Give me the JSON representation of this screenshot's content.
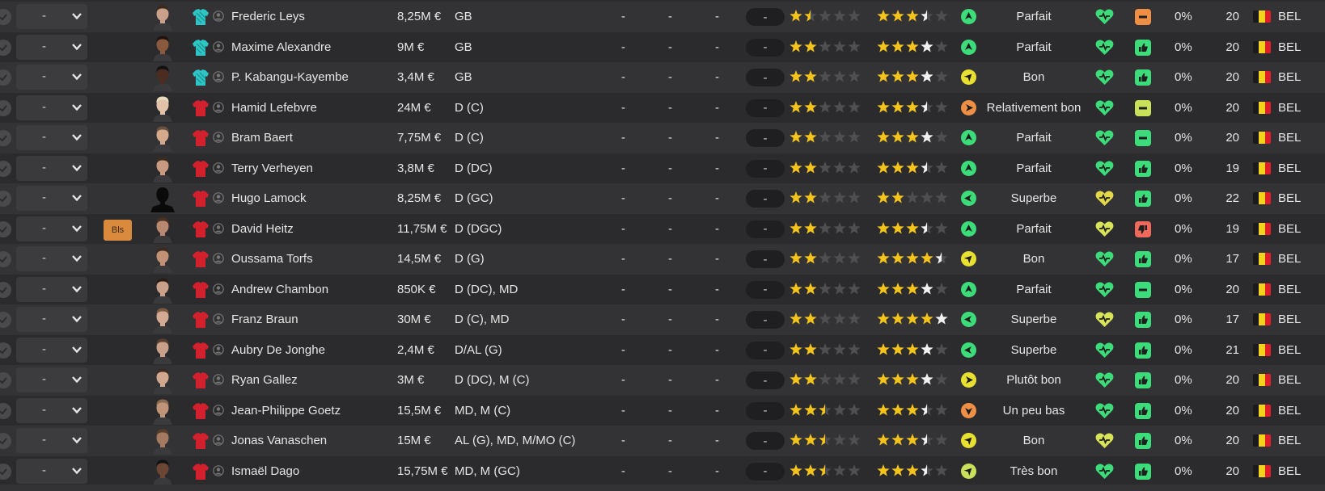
{
  "colors": {
    "star_gold": "#f5c41b",
    "star_white": "#f2f2f2",
    "star_empty": "#4f4f51",
    "heart_green": "#3ddc7a",
    "heart_yellow": "#d8e35a",
    "mood_green": "#3ddc7a",
    "mood_orange": "#ef8f45",
    "mood_red": "#ef6a5a",
    "mood_yellowgreen": "#c8e05a",
    "gk_shirt": "#2dc5c5",
    "outfield_shirt": "#d2202d",
    "badge": "#d98a3d"
  },
  "flag": {
    "black": "#1a1a1a",
    "yellow": "#f4d31e",
    "red": "#e01e2a"
  },
  "rows": [
    {
      "dash": "-",
      "badge": "",
      "shirt": "gk",
      "name": "Frederic Leys",
      "value": "8,25M €",
      "position": "GB",
      "d1": "-",
      "d2": "-",
      "d3": "-",
      "pill": "-",
      "stars1": 1.5,
      "stars2": 3.5,
      "arrow_icon": "up-arrow-green",
      "level": "Parfait",
      "heart_color": "green",
      "mood_icon": "minus-orange",
      "pct": "0%",
      "age": "20",
      "nat": "BEL"
    },
    {
      "dash": "-",
      "badge": "",
      "shirt": "gk",
      "name": "Maxime Alexandre",
      "value": "9M €",
      "position": "GB",
      "d1": "-",
      "d2": "-",
      "d3": "-",
      "pill": "-",
      "stars1": 2,
      "stars2": 3,
      "arrow_icon": "up-arrow-green",
      "level": "Parfait",
      "heart_color": "green",
      "mood_icon": "thumb-up-green",
      "pct": "0%",
      "age": "20",
      "nat": "BEL"
    },
    {
      "dash": "-",
      "badge": "",
      "shirt": "gk",
      "name": "P. Kabangu-Kayembe",
      "value": "3,4M €",
      "position": "GB",
      "d1": "-",
      "d2": "-",
      "d3": "-",
      "pill": "-",
      "stars1": 2,
      "stars2": 3,
      "arrow_icon": "diag-arrow-yellow",
      "level": "Bon",
      "heart_color": "green",
      "mood_icon": "thumb-up-green",
      "pct": "0%",
      "age": "20",
      "nat": "BEL"
    },
    {
      "dash": "-",
      "badge": "",
      "shirt": "field",
      "name": "Hamid Lefebvre",
      "value": "24M €",
      "position": "D (C)",
      "d1": "-",
      "d2": "-",
      "d3": "-",
      "pill": "-",
      "stars1": 2,
      "stars2": 3.5,
      "arrow_icon": "right-arrow-orange",
      "level": "Relativement bon",
      "heart_color": "green",
      "mood_icon": "minus-yellowgreen",
      "pct": "0%",
      "age": "20",
      "nat": "BEL"
    },
    {
      "dash": "-",
      "badge": "",
      "shirt": "field",
      "name": "Bram Baert",
      "value": "7,75M €",
      "position": "D (C)",
      "d1": "-",
      "d2": "-",
      "d3": "-",
      "pill": "-",
      "stars1": 2,
      "stars2": 3,
      "arrow_icon": "up-arrow-green",
      "level": "Parfait",
      "heart_color": "green",
      "mood_icon": "minus-green",
      "pct": "0%",
      "age": "20",
      "nat": "BEL"
    },
    {
      "dash": "-",
      "badge": "",
      "shirt": "field",
      "name": "Terry Verheyen",
      "value": "3,8M €",
      "position": "D (DC)",
      "d1": "-",
      "d2": "-",
      "d3": "-",
      "pill": "-",
      "stars1": 2,
      "stars2": 3.5,
      "arrow_icon": "up-arrow-green",
      "level": "Parfait",
      "heart_color": "green",
      "mood_icon": "thumb-up-green",
      "pct": "0%",
      "age": "19",
      "nat": "BEL"
    },
    {
      "dash": "-",
      "badge": "",
      "shirt": "field",
      "name": "Hugo Lamock",
      "value": "8,25M €",
      "position": "D (GC)",
      "d1": "-",
      "d2": "-",
      "d3": "-",
      "pill": "-",
      "stars1": 2,
      "stars2": 2,
      "arrow_icon": "left-arrow-green",
      "level": "Superbe",
      "heart_color": "yellow",
      "mood_icon": "thumb-up-green",
      "pct": "0%",
      "age": "22",
      "nat": "BEL"
    },
    {
      "dash": "-",
      "badge": "Bls",
      "shirt": "field",
      "name": "David Heitz",
      "value": "11,75M €",
      "position": "D (DGC)",
      "d1": "-",
      "d2": "-",
      "d3": "-",
      "pill": "-",
      "stars1": 2,
      "stars2": 3.5,
      "arrow_icon": "up-arrow-green",
      "level": "Parfait",
      "heart_color": "yellowgreen",
      "mood_icon": "thumb-down-red",
      "pct": "0%",
      "age": "19",
      "nat": "BEL"
    },
    {
      "dash": "-",
      "badge": "",
      "shirt": "field",
      "name": "Oussama Torfs",
      "value": "14,5M €",
      "position": "D (G)",
      "d1": "-",
      "d2": "-",
      "d3": "-",
      "pill": "-",
      "stars1": 2,
      "stars2": 4.5,
      "arrow_icon": "diag-arrow-yellow",
      "level": "Bon",
      "heart_color": "green",
      "mood_icon": "thumb-up-green",
      "pct": "0%",
      "age": "17",
      "nat": "BEL"
    },
    {
      "dash": "-",
      "badge": "",
      "shirt": "field",
      "name": "Andrew Chambon",
      "value": "850K €",
      "position": "D (DC), MD",
      "d1": "-",
      "d2": "-",
      "d3": "-",
      "pill": "-",
      "stars1": 2,
      "stars2": 3,
      "arrow_icon": "up-arrow-green",
      "level": "Parfait",
      "heart_color": "green",
      "mood_icon": "minus-green",
      "pct": "0%",
      "age": "20",
      "nat": "BEL"
    },
    {
      "dash": "-",
      "badge": "",
      "shirt": "field",
      "name": "Franz Braun",
      "value": "30M €",
      "position": "D (C), MD",
      "d1": "-",
      "d2": "-",
      "d3": "-",
      "pill": "-",
      "stars1": 2,
      "stars2": 4,
      "arrow_icon": "left-arrow-green",
      "level": "Superbe",
      "heart_color": "yellowgreen",
      "mood_icon": "thumb-up-green",
      "pct": "0%",
      "age": "17",
      "nat": "BEL"
    },
    {
      "dash": "-",
      "badge": "",
      "shirt": "field",
      "name": "Aubry De Jonghe",
      "value": "2,4M €",
      "position": "D/AL (G)",
      "d1": "-",
      "d2": "-",
      "d3": "-",
      "pill": "-",
      "stars1": 2,
      "stars2": 3,
      "arrow_icon": "left-arrow-green",
      "level": "Superbe",
      "heart_color": "green",
      "mood_icon": "thumb-up-green",
      "pct": "0%",
      "age": "21",
      "nat": "BEL"
    },
    {
      "dash": "-",
      "badge": "",
      "shirt": "field",
      "name": "Ryan Gallez",
      "value": "3M €",
      "position": "D (DC), M (C)",
      "d1": "-",
      "d2": "-",
      "d3": "-",
      "pill": "-",
      "stars1": 2,
      "stars2": 3,
      "arrow_icon": "right-arrow-yellow",
      "level": "Plutôt bon",
      "heart_color": "green",
      "mood_icon": "thumb-up-green",
      "pct": "0%",
      "age": "20",
      "nat": "BEL"
    },
    {
      "dash": "-",
      "badge": "",
      "shirt": "field",
      "name": "Jean-Philippe Goetz",
      "value": "15,5M €",
      "position": "MD, M (C)",
      "d1": "-",
      "d2": "-",
      "d3": "-",
      "pill": "-",
      "stars1": 2.5,
      "stars2": 3.5,
      "arrow_icon": "down-arrow-orange",
      "level": "Un peu bas",
      "heart_color": "green",
      "mood_icon": "thumb-up-green",
      "pct": "0%",
      "age": "20",
      "nat": "BEL"
    },
    {
      "dash": "-",
      "badge": "",
      "shirt": "field",
      "name": "Jonas Vanaschen",
      "value": "15M €",
      "position": "AL (G), MD, M/MO (C)",
      "d1": "-",
      "d2": "-",
      "d3": "-",
      "pill": "-",
      "stars1": 2.5,
      "stars2": 3.5,
      "arrow_icon": "diag-arrow-yellow",
      "level": "Bon",
      "heart_color": "yellowgreen",
      "mood_icon": "thumb-up-green",
      "pct": "0%",
      "age": "20",
      "nat": "BEL"
    },
    {
      "dash": "-",
      "badge": "",
      "shirt": "field",
      "name": "Ismaël Dago",
      "value": "15,75M €",
      "position": "MD, M (GC)",
      "d1": "-",
      "d2": "-",
      "d3": "-",
      "pill": "-",
      "stars1": 2.5,
      "stars2": 3.5,
      "arrow_icon": "diag-arrow-yellowgreen",
      "level": "Très bon",
      "heart_color": "green",
      "mood_icon": "thumb-up-green",
      "pct": "0%",
      "age": "20",
      "nat": "BEL"
    }
  ]
}
